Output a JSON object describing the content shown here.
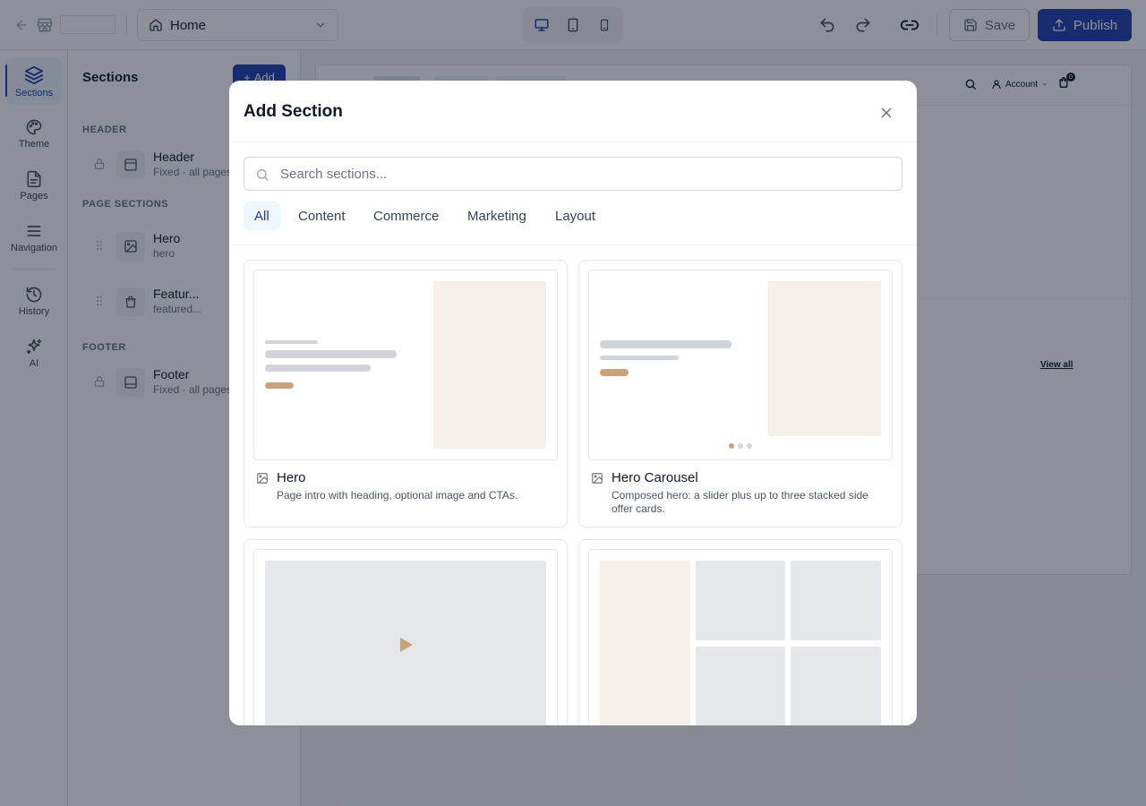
{
  "topbar": {
    "page_select_value": "Home",
    "save_label": "Save",
    "publish_label": "Publish"
  },
  "rail": {
    "items": [
      {
        "label": "Sections",
        "icon": "layers-icon"
      },
      {
        "label": "Theme",
        "icon": "palette-icon"
      },
      {
        "label": "Pages",
        "icon": "file-icon"
      },
      {
        "label": "Navigation",
        "icon": "menu-icon"
      },
      {
        "label": "History",
        "icon": "history-icon"
      },
      {
        "label": "AI",
        "icon": "sparkles-icon"
      }
    ]
  },
  "panel": {
    "title": "Sections",
    "add_label": "Add",
    "groups": {
      "header": "HEADER",
      "page_sections": "PAGE SECTIONS",
      "footer": "FOOTER"
    },
    "sections": [
      {
        "name": "Header",
        "sub": "Fixed · all pages"
      },
      {
        "name": "Hero",
        "sub": "hero"
      },
      {
        "name": "Featur...",
        "sub": "featured..."
      },
      {
        "name": "Footer",
        "sub": "Fixed · all pages"
      }
    ]
  },
  "canvas": {
    "account_label": "Account",
    "cart_count": "0",
    "view_all": "View all"
  },
  "modal": {
    "title": "Add Section",
    "search_placeholder": "Search sections...",
    "search_value": "",
    "tabs": [
      "All",
      "Content",
      "Commerce",
      "Marketing",
      "Layout"
    ],
    "active_tab": "All",
    "cards": [
      {
        "name": "Hero",
        "desc": "Page intro with heading, optional image and CTAs.",
        "icon": "image-icon"
      },
      {
        "name": "Hero Carousel",
        "desc": "Composed hero: a slider plus up to three stacked side offer cards.",
        "icon": "image-icon"
      }
    ]
  },
  "colors": {
    "accent": "#1e40af",
    "tan": "#c9a27a",
    "beige": "#f5f0e9"
  }
}
